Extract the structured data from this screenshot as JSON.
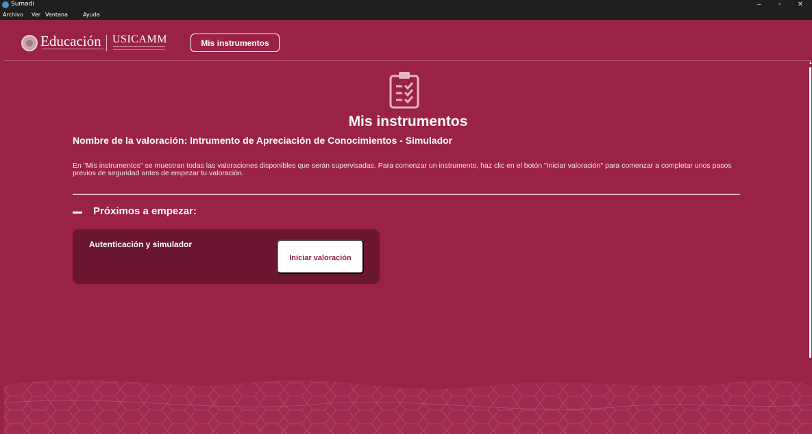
{
  "window": {
    "title": "Sumadi",
    "controls": {
      "minimize": "–",
      "restore": "▫",
      "close": "✕"
    }
  },
  "menu": {
    "items": [
      "Archivo",
      "Ver",
      "Ventana",
      "Ayuda"
    ]
  },
  "header": {
    "brand_primary": "Educación",
    "brand_secondary": "USICAMM",
    "nav_button": "Mis instrumentos"
  },
  "main": {
    "icon": "clipboard-check-icon",
    "title": "Mis instrumentos",
    "subtitle": "Nombre de la valoración: Intrumento de Apreciación de Conocimientos - Simulador",
    "description": "En \"Mis instrumentos\" se muestran todas las valoraciones disponibles que serán supervisadas. Para comenzar un instrumento, haz clic en el botón \"Iniciar valoración\" para comenzar a completar unos pasos previos de seguridad antes de empezar tu valoración.",
    "section_title": "Próximos a empezar:",
    "card": {
      "title": "Autenticación y simulador",
      "button": "Iniciar valoración"
    }
  },
  "colors": {
    "background": "#9b2247",
    "card": "#6b1630",
    "titlebar": "#1f1f1f"
  }
}
